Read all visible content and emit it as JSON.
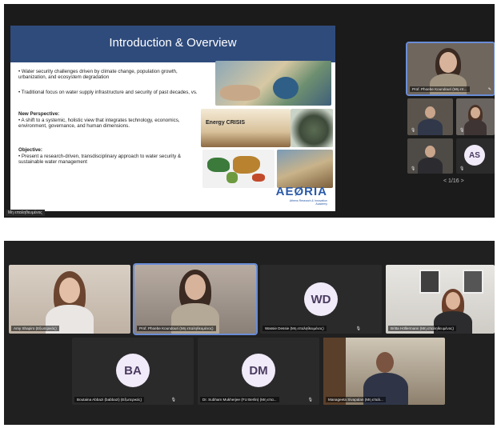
{
  "top_screenshot": {
    "slide": {
      "title": "Introduction & Overview",
      "bullet1": "• Water security challenges driven by climate change, population growth, urbanization, and ecosystem degradation",
      "bullet2": "• Traditional focus on water supply infrastructure and security of past decades, vs.",
      "new_perspective_heading": "New Perspective:",
      "new_perspective_text": "• A shift to a systemic, holistic view that integrates technology, economics, environment, governance, and human dimensions.",
      "objective_heading": "Objective:",
      "objective_text": "• Present a research-driven, transdisciplinary approach to water security & sustainable water management",
      "image_caption_energy": "Energy CRISIS",
      "logo": "AEØRIA",
      "logo_subtitle": "Athens Research & Innovation Academy"
    },
    "presenter_label": "Μη επαληθευμένος",
    "speaker_tile_name": "Prof. Phoebe Koundouri (Μη επ...",
    "avatar_initials": "AS",
    "pager": "< 1/16 >"
  },
  "bottom_screenshot": {
    "participants": [
      {
        "name": "Amy Shapiro (Εξωτερικός)"
      },
      {
        "name": "Prof. Phoebe Koundouri (Μη επαληθευμένος)"
      },
      {
        "name": "Wassie Dessie (Μη επαληθευμένος)",
        "initials": "WD"
      },
      {
        "name": "Britta Höllermann (Μη επαληθευμένος)"
      },
      {
        "name": "Boutaina Abbazi (babbazi) (Εξωτερικός)",
        "initials": "BA"
      },
      {
        "name": "Dr. Subham Mukherjee (FU Berlin) (Μη επα...",
        "initials": "DM"
      },
      {
        "name": "Manageeta Sivapalan (Μη επαλ..."
      }
    ]
  },
  "colors": {
    "slide_header": "#2f4b7c",
    "avatar_bg": "#f1eaf8",
    "avatar_text": "#4a3b60",
    "active_outline": "#6a8dd6"
  }
}
